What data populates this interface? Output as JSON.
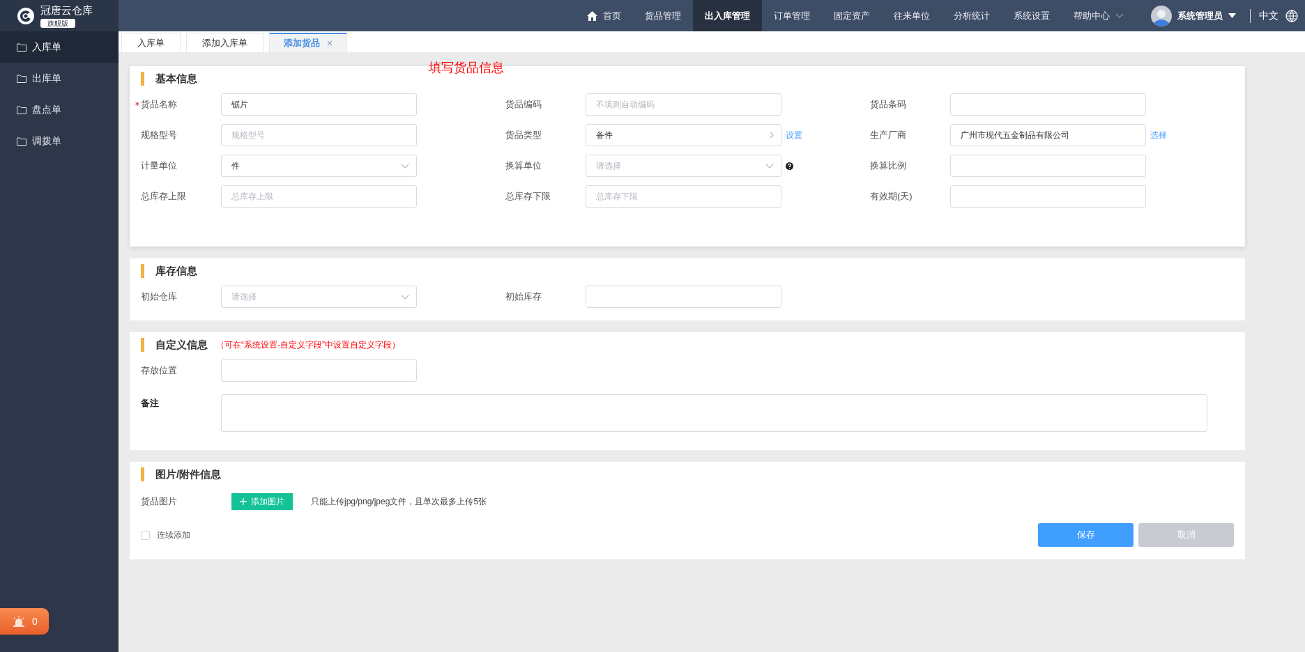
{
  "brand": {
    "name": "冠唐云仓库",
    "edition": "旗舰版"
  },
  "nav": {
    "items": [
      {
        "label": "首页",
        "kind": "home",
        "selected": false
      },
      {
        "label": "货品管理",
        "kind": "link",
        "selected": false
      },
      {
        "label": "出入库管理",
        "kind": "link",
        "selected": true
      },
      {
        "label": "订单管理",
        "kind": "link",
        "selected": false
      },
      {
        "label": "固定资产",
        "kind": "link",
        "selected": false
      },
      {
        "label": "往来单位",
        "kind": "link",
        "selected": false
      },
      {
        "label": "分析统计",
        "kind": "link",
        "selected": false
      },
      {
        "label": "系统设置",
        "kind": "link",
        "selected": false
      },
      {
        "label": "帮助中心",
        "kind": "menu",
        "selected": false
      }
    ]
  },
  "user": {
    "name": "系统管理员"
  },
  "language": {
    "label": "中文"
  },
  "sidebar": {
    "items": [
      {
        "label": "入库单",
        "selected": true
      },
      {
        "label": "出库单",
        "selected": false
      },
      {
        "label": "盘点单",
        "selected": false
      },
      {
        "label": "调拨单",
        "selected": false
      }
    ],
    "alarm": {
      "count": "0"
    }
  },
  "tabs": [
    {
      "label": "入库单",
      "selected": false,
      "closable": false
    },
    {
      "label": "添加入库单",
      "selected": false,
      "closable": false
    },
    {
      "label": "添加货品",
      "selected": true,
      "closable": true
    }
  ],
  "annotation": "填写货品信息",
  "sections": [
    {
      "title": "基本信息",
      "fields": [
        {
          "label": "货品名称",
          "required": true,
          "help": false,
          "kind": "text",
          "value": "锯片"
        },
        {
          "label": "货品编码",
          "required": false,
          "help": false,
          "kind": "text",
          "placeholder": "不填则自动编码"
        },
        {
          "label": "货品条码",
          "required": false,
          "help": false,
          "kind": "text"
        },
        {
          "label": "规格型号",
          "required": false,
          "help": false,
          "kind": "text",
          "placeholder": "规格型号"
        },
        {
          "label": "货品类型",
          "required": false,
          "help": false,
          "kind": "cascader",
          "value": "备件",
          "action": "设置"
        },
        {
          "label": "生产厂商",
          "required": false,
          "help": false,
          "kind": "text",
          "value": "广州市现代五金制品有限公司",
          "action": "选择"
        },
        {
          "label": "计量单位",
          "required": false,
          "help": false,
          "kind": "select",
          "value": "件"
        },
        {
          "label": "换算单位",
          "required": false,
          "help": true,
          "kind": "select",
          "placeholder": "请选择"
        },
        {
          "label": "换算比例",
          "required": false,
          "help": false,
          "kind": "text"
        },
        {
          "label": "总库存上限",
          "required": false,
          "help": false,
          "kind": "text",
          "placeholder": "总库存上限"
        },
        {
          "label": "总库存下限",
          "required": false,
          "help": false,
          "kind": "text",
          "placeholder": "总库存下限"
        },
        {
          "label": "有效期(天)",
          "required": false,
          "help": false,
          "kind": "text"
        }
      ]
    },
    {
      "title": "库存信息",
      "fields": [
        {
          "label": "初始仓库",
          "required": false,
          "help": false,
          "kind": "select",
          "placeholder": "请选择"
        },
        {
          "label": "初始库存",
          "required": false,
          "help": false,
          "kind": "text"
        }
      ]
    },
    {
      "title": "自定义信息",
      "note": "（可在“系统设置-自定义字段”中设置自定义字段）",
      "fields": [
        {
          "label": "存放位置",
          "required": false,
          "help": false,
          "kind": "text"
        },
        {
          "label": "备注",
          "required": false,
          "help": false,
          "kind": "textarea"
        }
      ]
    },
    {
      "title": "图片/附件信息",
      "fields": [
        {
          "label": "货品图片",
          "required": false,
          "help": false,
          "kind": "upload",
          "button": "添加图片",
          "hint": "只能上传jpg/png/jpeg文件，且单次最多上传5张"
        }
      ],
      "option": {
        "label": "连续添加",
        "checked": false
      },
      "buttons": [
        {
          "label": "保存",
          "kind": "primary"
        },
        {
          "label": "取消",
          "kind": "secondary"
        }
      ]
    }
  ]
}
